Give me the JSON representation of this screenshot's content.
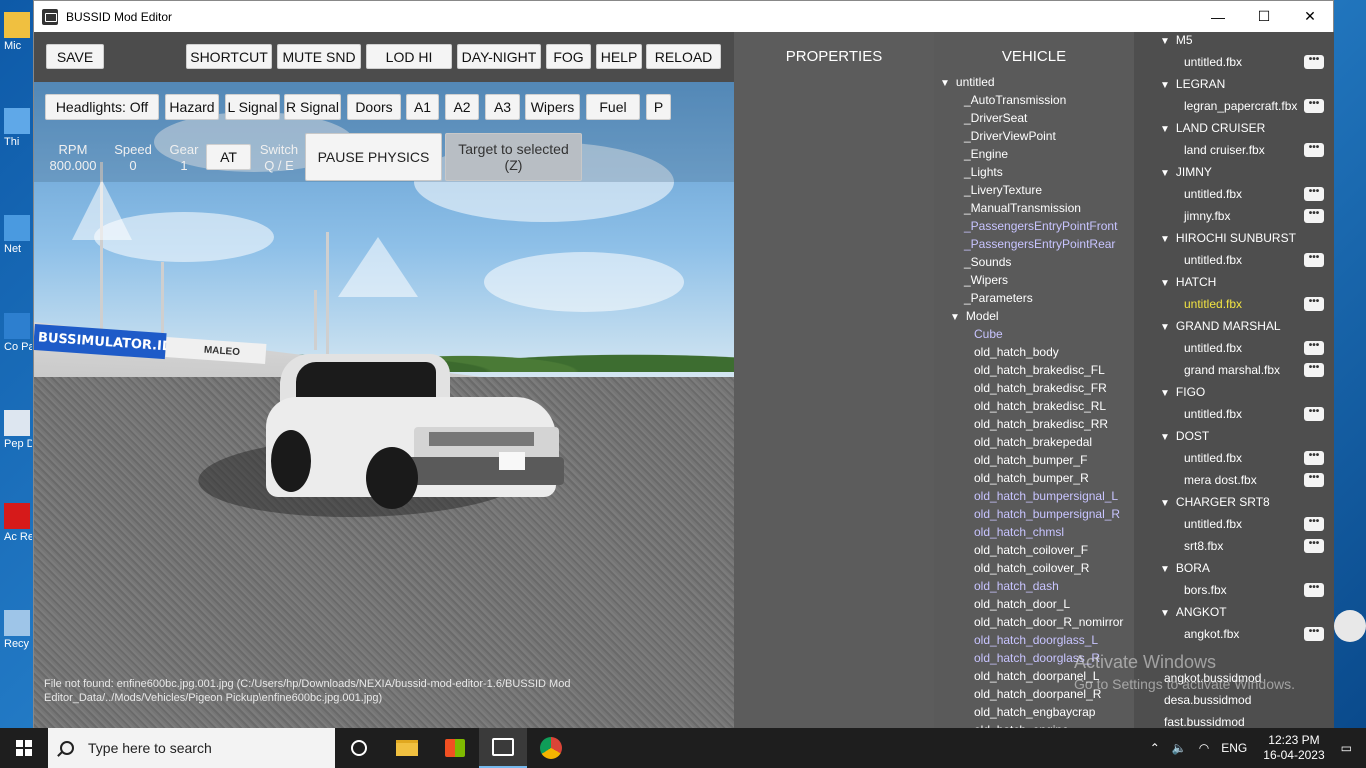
{
  "window": {
    "title": "BUSSID Mod Editor",
    "minimize": "—",
    "maximize": "☐",
    "close": "✕"
  },
  "toolbar": {
    "save": "SAVE",
    "shortcut": "SHORTCUT",
    "mute": "MUTE SND",
    "lod": "LOD HI",
    "daynight": "DAY-NIGHT",
    "fog": "FOG",
    "help": "HELP",
    "reload": "RELOAD"
  },
  "controls": {
    "headlights": "Headlights: Off",
    "hazard": "Hazard",
    "lsignal": "L Signal",
    "rsignal": "R Signal",
    "doors": "Doors",
    "a1": "A1",
    "a2": "A2",
    "a3": "A3",
    "wipers": "Wipers",
    "fuel": "Fuel",
    "p": "P"
  },
  "hud": {
    "rpm_label": "RPM",
    "rpm_value": "800.000",
    "speed_label": "Speed",
    "speed_value": "0",
    "gear_label": "Gear",
    "gear_value": "1",
    "at": "AT",
    "switch_label": "Switch",
    "switch_keys": "Q / E",
    "pause": "PAUSE PHYSICS",
    "target_line1": "Target to selected",
    "target_line2": "(Z)"
  },
  "scene": {
    "banner": "BUSSIMULATOR.ID",
    "banner2": "MALEO"
  },
  "error": "File not found: enfine600bc.jpg.001.jpg (C:/Users/hp/Downloads/NEXIA/bussid-mod-editor-1.6/BUSSID Mod Editor_Data/../Mods/Vehicles/Pigeon Pickup\\enfine600bc.jpg.001.jpg)",
  "properties": {
    "header": "PROPERTIES"
  },
  "vehicle": {
    "header": "VEHICLE",
    "root": "untitled",
    "items": [
      "_AutoTransmission",
      "_DriverSeat",
      "_DriverViewPoint",
      "_Engine",
      "_Lights",
      "_LiveryTexture",
      "_ManualTransmission",
      "_PassengersEntryPointFront",
      "_PassengersEntryPointRear",
      "_Sounds",
      "_Wipers",
      "_Parameters"
    ],
    "model": "Model",
    "model_items": [
      "Cube",
      "old_hatch_body",
      "old_hatch_brakedisc_FL",
      "old_hatch_brakedisc_FR",
      "old_hatch_brakedisc_RL",
      "old_hatch_brakedisc_RR",
      "old_hatch_brakepedal",
      "old_hatch_bumper_F",
      "old_hatch_bumper_R",
      "old_hatch_bumpersignal_L",
      "old_hatch_bumpersignal_R",
      "old_hatch_chmsl",
      "old_hatch_coilover_F",
      "old_hatch_coilover_R",
      "old_hatch_dash",
      "old_hatch_door_L",
      "old_hatch_door_R_nomirror",
      "old_hatch_doorglass_L",
      "old_hatch_doorglass_R",
      "old_hatch_doorpanel_L",
      "old_hatch_doorpanel_R",
      "old_hatch_engbaycrap",
      "old_hatch_engine"
    ]
  },
  "mods": {
    "groups": [
      {
        "name": "M5",
        "files": [
          "untitled.fbx"
        ]
      },
      {
        "name": "LEGRAN",
        "files": [
          "legran_papercraft.fbx"
        ]
      },
      {
        "name": "LAND CRUISER",
        "files": [
          "land cruiser.fbx"
        ]
      },
      {
        "name": "JIMNY",
        "files": [
          "untitled.fbx",
          "jimny.fbx"
        ]
      },
      {
        "name": "HIROCHI SUNBURST",
        "files": [
          "untitled.fbx"
        ]
      },
      {
        "name": "HATCH",
        "files": [
          "untitled.fbx"
        ]
      },
      {
        "name": "GRAND MARSHAL",
        "files": [
          "untitled.fbx",
          "grand marshal.fbx"
        ]
      },
      {
        "name": "FIGO",
        "files": [
          "untitled.fbx"
        ]
      },
      {
        "name": "DOST",
        "files": [
          "untitled.fbx",
          "mera dost.fbx"
        ]
      },
      {
        "name": "CHARGER SRT8",
        "files": [
          "untitled.fbx",
          "srt8.fbx"
        ]
      },
      {
        "name": "BORA",
        "files": [
          "bors.fbx"
        ]
      },
      {
        "name": "ANGKOT",
        "files": [
          "angkot.fbx"
        ]
      }
    ],
    "dots": "•••",
    "bussid_files": [
      "angkot.bussidmod",
      "desa.bussidmod",
      "fast.bussidmod"
    ]
  },
  "watermark": {
    "line1": "Activate Windows",
    "line2": "Go to Settings to activate Windows."
  },
  "taskbar": {
    "search_placeholder": "Type here to search",
    "lang": "ENG",
    "time": "12:23 PM",
    "date": "16-04-2023"
  },
  "desktop": {
    "icon_labels": [
      "Mic",
      "Thi",
      "Net",
      "Co Pa",
      "Pep Desi",
      "Ac Rea",
      "Recy"
    ]
  }
}
